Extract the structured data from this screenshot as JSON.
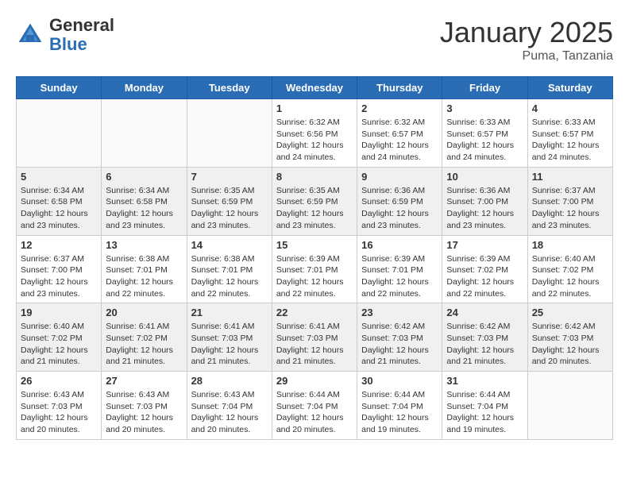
{
  "header": {
    "logo_general": "General",
    "logo_blue": "Blue",
    "month_title": "January 2025",
    "subtitle": "Puma, Tanzania"
  },
  "weekdays": [
    "Sunday",
    "Monday",
    "Tuesday",
    "Wednesday",
    "Thursday",
    "Friday",
    "Saturday"
  ],
  "weeks": [
    {
      "shaded": false,
      "days": [
        {
          "num": "",
          "info": ""
        },
        {
          "num": "",
          "info": ""
        },
        {
          "num": "",
          "info": ""
        },
        {
          "num": "1",
          "info": "Sunrise: 6:32 AM\nSunset: 6:56 PM\nDaylight: 12 hours\nand 24 minutes."
        },
        {
          "num": "2",
          "info": "Sunrise: 6:32 AM\nSunset: 6:57 PM\nDaylight: 12 hours\nand 24 minutes."
        },
        {
          "num": "3",
          "info": "Sunrise: 6:33 AM\nSunset: 6:57 PM\nDaylight: 12 hours\nand 24 minutes."
        },
        {
          "num": "4",
          "info": "Sunrise: 6:33 AM\nSunset: 6:57 PM\nDaylight: 12 hours\nand 24 minutes."
        }
      ]
    },
    {
      "shaded": true,
      "days": [
        {
          "num": "5",
          "info": "Sunrise: 6:34 AM\nSunset: 6:58 PM\nDaylight: 12 hours\nand 23 minutes."
        },
        {
          "num": "6",
          "info": "Sunrise: 6:34 AM\nSunset: 6:58 PM\nDaylight: 12 hours\nand 23 minutes."
        },
        {
          "num": "7",
          "info": "Sunrise: 6:35 AM\nSunset: 6:59 PM\nDaylight: 12 hours\nand 23 minutes."
        },
        {
          "num": "8",
          "info": "Sunrise: 6:35 AM\nSunset: 6:59 PM\nDaylight: 12 hours\nand 23 minutes."
        },
        {
          "num": "9",
          "info": "Sunrise: 6:36 AM\nSunset: 6:59 PM\nDaylight: 12 hours\nand 23 minutes."
        },
        {
          "num": "10",
          "info": "Sunrise: 6:36 AM\nSunset: 7:00 PM\nDaylight: 12 hours\nand 23 minutes."
        },
        {
          "num": "11",
          "info": "Sunrise: 6:37 AM\nSunset: 7:00 PM\nDaylight: 12 hours\nand 23 minutes."
        }
      ]
    },
    {
      "shaded": false,
      "days": [
        {
          "num": "12",
          "info": "Sunrise: 6:37 AM\nSunset: 7:00 PM\nDaylight: 12 hours\nand 23 minutes."
        },
        {
          "num": "13",
          "info": "Sunrise: 6:38 AM\nSunset: 7:01 PM\nDaylight: 12 hours\nand 22 minutes."
        },
        {
          "num": "14",
          "info": "Sunrise: 6:38 AM\nSunset: 7:01 PM\nDaylight: 12 hours\nand 22 minutes."
        },
        {
          "num": "15",
          "info": "Sunrise: 6:39 AM\nSunset: 7:01 PM\nDaylight: 12 hours\nand 22 minutes."
        },
        {
          "num": "16",
          "info": "Sunrise: 6:39 AM\nSunset: 7:01 PM\nDaylight: 12 hours\nand 22 minutes."
        },
        {
          "num": "17",
          "info": "Sunrise: 6:39 AM\nSunset: 7:02 PM\nDaylight: 12 hours\nand 22 minutes."
        },
        {
          "num": "18",
          "info": "Sunrise: 6:40 AM\nSunset: 7:02 PM\nDaylight: 12 hours\nand 22 minutes."
        }
      ]
    },
    {
      "shaded": true,
      "days": [
        {
          "num": "19",
          "info": "Sunrise: 6:40 AM\nSunset: 7:02 PM\nDaylight: 12 hours\nand 21 minutes."
        },
        {
          "num": "20",
          "info": "Sunrise: 6:41 AM\nSunset: 7:02 PM\nDaylight: 12 hours\nand 21 minutes."
        },
        {
          "num": "21",
          "info": "Sunrise: 6:41 AM\nSunset: 7:03 PM\nDaylight: 12 hours\nand 21 minutes."
        },
        {
          "num": "22",
          "info": "Sunrise: 6:41 AM\nSunset: 7:03 PM\nDaylight: 12 hours\nand 21 minutes."
        },
        {
          "num": "23",
          "info": "Sunrise: 6:42 AM\nSunset: 7:03 PM\nDaylight: 12 hours\nand 21 minutes."
        },
        {
          "num": "24",
          "info": "Sunrise: 6:42 AM\nSunset: 7:03 PM\nDaylight: 12 hours\nand 21 minutes."
        },
        {
          "num": "25",
          "info": "Sunrise: 6:42 AM\nSunset: 7:03 PM\nDaylight: 12 hours\nand 20 minutes."
        }
      ]
    },
    {
      "shaded": false,
      "days": [
        {
          "num": "26",
          "info": "Sunrise: 6:43 AM\nSunset: 7:03 PM\nDaylight: 12 hours\nand 20 minutes."
        },
        {
          "num": "27",
          "info": "Sunrise: 6:43 AM\nSunset: 7:03 PM\nDaylight: 12 hours\nand 20 minutes."
        },
        {
          "num": "28",
          "info": "Sunrise: 6:43 AM\nSunset: 7:04 PM\nDaylight: 12 hours\nand 20 minutes."
        },
        {
          "num": "29",
          "info": "Sunrise: 6:44 AM\nSunset: 7:04 PM\nDaylight: 12 hours\nand 20 minutes."
        },
        {
          "num": "30",
          "info": "Sunrise: 6:44 AM\nSunset: 7:04 PM\nDaylight: 12 hours\nand 19 minutes."
        },
        {
          "num": "31",
          "info": "Sunrise: 6:44 AM\nSunset: 7:04 PM\nDaylight: 12 hours\nand 19 minutes."
        },
        {
          "num": "",
          "info": ""
        }
      ]
    }
  ]
}
